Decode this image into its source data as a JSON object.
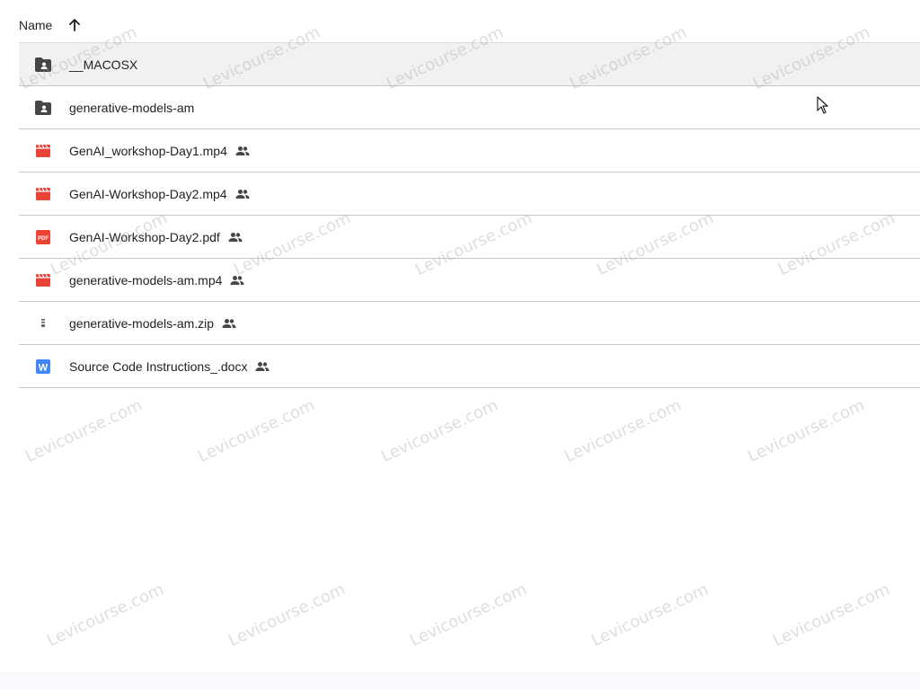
{
  "header": {
    "name_label": "Name",
    "sort_icon": "arrow-up-icon"
  },
  "files": [
    {
      "name": "__MACOSX",
      "icon": "shared-folder-icon",
      "shared": false,
      "selected": true
    },
    {
      "name": "generative-models-am",
      "icon": "shared-folder-icon",
      "shared": false,
      "selected": false
    },
    {
      "name": "GenAI_workshop-Day1.mp4",
      "icon": "video-file-icon",
      "shared": true,
      "selected": false
    },
    {
      "name": "GenAI-Workshop-Day2.mp4",
      "icon": "video-file-icon",
      "shared": true,
      "selected": false
    },
    {
      "name": "GenAI-Workshop-Day2.pdf",
      "icon": "pdf-file-icon",
      "shared": true,
      "selected": false
    },
    {
      "name": "generative-models-am.mp4",
      "icon": "video-file-icon",
      "shared": true,
      "selected": false
    },
    {
      "name": "generative-models-am.zip",
      "icon": "zip-file-icon",
      "shared": true,
      "selected": false
    },
    {
      "name": "Source Code Instructions_.docx",
      "icon": "word-doc-icon",
      "shared": true,
      "selected": false
    }
  ],
  "watermark": {
    "text": "Levicourse.com"
  },
  "colors": {
    "folder": "#444746",
    "video": "#ea4335",
    "pdf": "#ea4335",
    "word": "#4285f4",
    "selected_row": "#f1f1f1",
    "divider": "#c7c7c7"
  }
}
